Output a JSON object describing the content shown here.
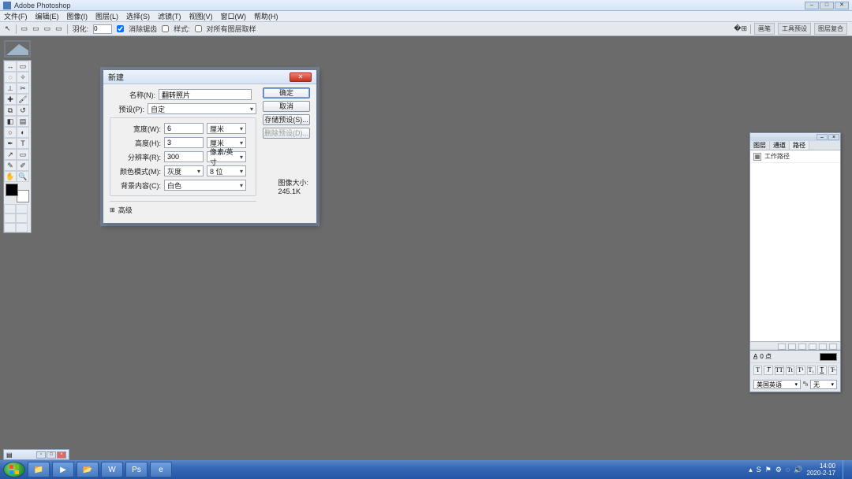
{
  "titlebar": {
    "app_name": "Adobe Photoshop"
  },
  "menubar": {
    "file": "文件(F)",
    "edit": "编辑(E)",
    "image": "图像(I)",
    "layer": "图层(L)",
    "select": "选择(S)",
    "filter": "滤镜(T)",
    "view": "视图(V)",
    "window": "窗口(W)",
    "help": "帮助(H)"
  },
  "optbar": {
    "feather_label": "羽化:",
    "feather_value": "0",
    "antialias_label": "消除锯齿",
    "style_label": "样式:",
    "style_value": "",
    "refine_label": "对所有图层取样",
    "panel_history": "画笔",
    "panel_tool": "工具预设",
    "panel_comp": "图层复合"
  },
  "dialog": {
    "title": "新建",
    "name_label": "名称(N):",
    "name_value": "翻转照片",
    "preset_label": "预设(P):",
    "preset_value": "自定",
    "width_label": "宽度(W):",
    "width_value": "6",
    "width_unit": "厘米",
    "height_label": "高度(H):",
    "height_value": "3",
    "height_unit": "厘米",
    "res_label": "分辨率(R):",
    "res_value": "300",
    "res_unit": "像素/英寸",
    "mode_label": "颜色模式(M):",
    "mode_value": "灰度",
    "mode_bits": "8 位",
    "bg_label": "背景内容(C):",
    "bg_value": "白色",
    "advanced_label": "高级",
    "ok": "确定",
    "cancel": "取消",
    "save_preset": "存储预设(S)...",
    "delete_preset": "删除预设(D)...",
    "size_label": "图像大小:",
    "size_value": "245.1K"
  },
  "layers_panel": {
    "tab_layers": "图层",
    "tab_channels": "通道",
    "tab_paths": "路径",
    "path_name": "工作路径"
  },
  "char_panel": {
    "opacity_label": "0 点",
    "lang_value": "美国英语",
    "aa_value": "无"
  },
  "taskbar": {
    "time": "14:00",
    "date": "2020-2-17"
  }
}
